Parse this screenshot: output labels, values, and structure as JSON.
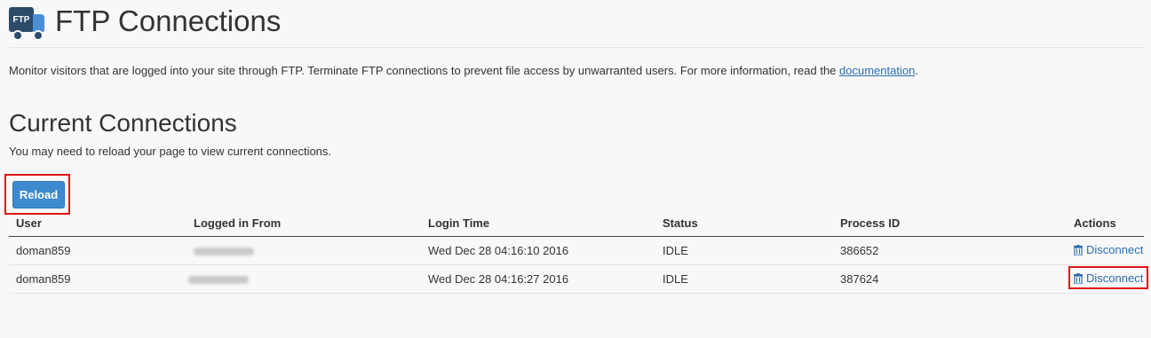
{
  "header": {
    "icon_label": "FTP",
    "title": "FTP Connections"
  },
  "intro": {
    "text": "Monitor visitors that are logged into your site through FTP. Terminate FTP connections to prevent file access by unwarranted users. For more information, read the ",
    "link": "documentation",
    "end": "."
  },
  "section": {
    "title": "Current Connections",
    "hint": "You may need to reload your page to view current connections.",
    "reload_label": "Reload"
  },
  "table": {
    "columns": [
      "User",
      "Logged in From",
      "Login Time",
      "Status",
      "Process ID",
      "Actions"
    ],
    "rows": [
      {
        "user": "doman859",
        "login_time": "Wed Dec 28 04:16:10 2016",
        "status": "IDLE",
        "pid": "386652",
        "action": "Disconnect"
      },
      {
        "user": "doman859",
        "login_time": "Wed Dec 28 04:16:27 2016",
        "status": "IDLE",
        "pid": "387624",
        "action": "Disconnect"
      }
    ]
  },
  "colors": {
    "accent": "#3d8ad0",
    "link": "#2a6db0",
    "highlight": "#e01515"
  }
}
